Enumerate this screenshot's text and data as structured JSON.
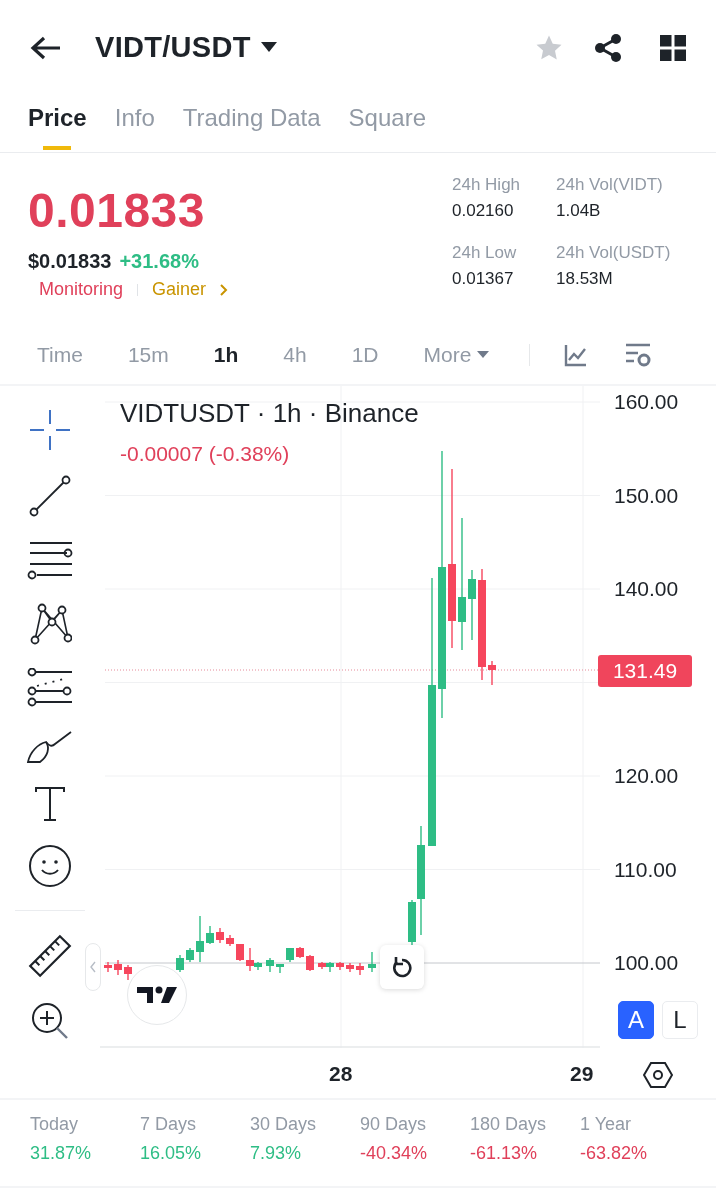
{
  "header": {
    "title": "VIDT/USDT",
    "favorite": false
  },
  "tabs": [
    {
      "label": "Price",
      "selected": true
    },
    {
      "label": "Info",
      "selected": false
    },
    {
      "label": "Trading Data",
      "selected": false
    },
    {
      "label": "Square",
      "selected": false
    }
  ],
  "ticker": {
    "price": "0.01833",
    "price_usd": "$0.01833",
    "change": "+31.68%",
    "tags": [
      {
        "label": "Monitoring",
        "kind": "risk"
      },
      {
        "label": "Gainer",
        "kind": "trend"
      }
    ]
  },
  "stats": [
    {
      "label": "24h High",
      "value": "0.02160"
    },
    {
      "label": "24h Vol(VIDT)",
      "value": "1.04B"
    },
    {
      "label": "24h Low",
      "value": "0.01367"
    },
    {
      "label": "24h Vol(USDT)",
      "value": "18.53M"
    }
  ],
  "intervals": [
    {
      "label": "Time",
      "kind": "plain",
      "selected": false
    },
    {
      "label": "15m",
      "kind": "plain",
      "selected": false
    },
    {
      "label": "1h",
      "kind": "plain",
      "selected": true
    },
    {
      "label": "4h",
      "kind": "plain",
      "selected": false
    },
    {
      "label": "1D",
      "kind": "plain",
      "selected": false
    },
    {
      "label": "More",
      "kind": "menu",
      "selected": false
    }
  ],
  "chart": {
    "title": "VIDTUSDT · 1h · Binance",
    "change": "-0.00007 (-0.38%)",
    "y_ticks": [
      "160.00",
      "150.00",
      "140.00",
      "120.00",
      "110.00",
      "100.00"
    ],
    "last_price": "131.49",
    "x_ticks": [
      "28",
      "29"
    ],
    "scale_modes": [
      {
        "label": "A",
        "selected": true
      },
      {
        "label": "L",
        "selected": false
      }
    ]
  },
  "performance": [
    {
      "label": "Today",
      "value": "31.87%",
      "color": "#2ebd85"
    },
    {
      "label": "7 Days",
      "value": "16.05%",
      "color": "#2ebd85"
    },
    {
      "label": "30 Days",
      "value": "7.93%",
      "color": "#2ebd85"
    },
    {
      "label": "90 Days",
      "value": "-40.34%",
      "color": "#e0405a"
    },
    {
      "label": "180 Days",
      "value": "-61.13%",
      "color": "#e0405a"
    },
    {
      "label": "1 Year",
      "value": "-63.82%",
      "color": "#e0405a"
    }
  ]
}
